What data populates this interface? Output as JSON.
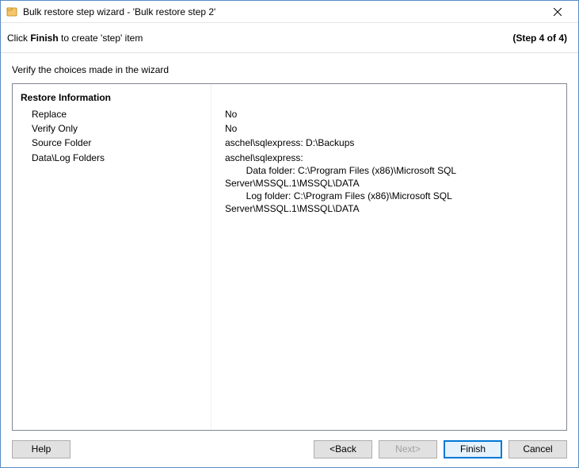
{
  "titlebar": {
    "title": "Bulk restore step wizard - 'Bulk restore step 2'"
  },
  "subheader": {
    "instruction_prefix": "Click ",
    "instruction_bold": "Finish",
    "instruction_suffix": " to create 'step' item",
    "step_label": "(Step 4 of 4)"
  },
  "body": {
    "verify_label": "Verify the choices made in the wizard",
    "section_title": "Restore Information",
    "rows": {
      "replace": {
        "label": "Replace",
        "value": "No"
      },
      "verify_only": {
        "label": "Verify Only",
        "value": "No"
      },
      "source_folder": {
        "label": "Source Folder",
        "value": "aschel\\sqlexpress: D:\\Backups"
      },
      "data_log": {
        "label": "Data\\Log Folders",
        "value": "aschel\\sqlexpress:\n        Data folder: C:\\Program Files (x86)\\Microsoft SQL Server\\MSSQL.1\\MSSQL\\DATA\n        Log folder: C:\\Program Files (x86)\\Microsoft SQL Server\\MSSQL.1\\MSSQL\\DATA"
      }
    }
  },
  "buttons": {
    "help": "Help",
    "back": "<Back",
    "next": "Next>",
    "finish": "Finish",
    "cancel": "Cancel"
  }
}
